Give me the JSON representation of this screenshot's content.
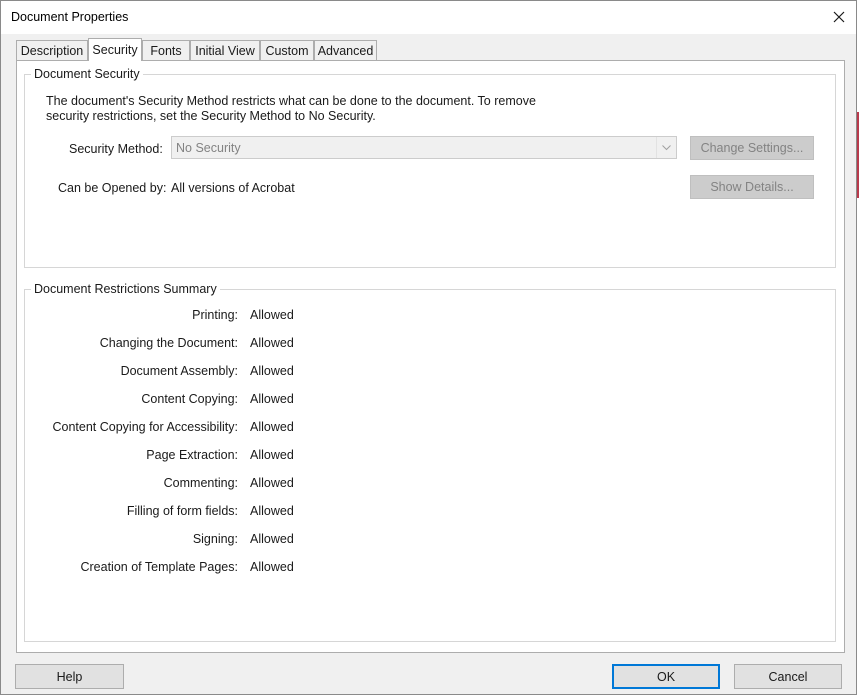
{
  "window": {
    "title": "Document Properties"
  },
  "tabs": [
    {
      "label": "Description",
      "active": false
    },
    {
      "label": "Security",
      "active": true
    },
    {
      "label": "Fonts",
      "active": false
    },
    {
      "label": "Initial View",
      "active": false
    },
    {
      "label": "Custom",
      "active": false
    },
    {
      "label": "Advanced",
      "active": false
    }
  ],
  "document_security": {
    "group_label": "Document Security",
    "description_line1": "The document's Security Method restricts what can be done to the document. To remove",
    "description_line2": "security restrictions, set the Security Method to No Security.",
    "method_label": "Security Method:",
    "method_value": "No Security",
    "change_settings_label": "Change Settings...",
    "opened_by_label": "Can be Opened by:",
    "opened_by_value": "All versions of Acrobat",
    "show_details_label": "Show Details..."
  },
  "restrictions": {
    "group_label": "Document Restrictions Summary",
    "rows": [
      {
        "label": "Printing:",
        "value": "Allowed"
      },
      {
        "label": "Changing the Document:",
        "value": "Allowed"
      },
      {
        "label": "Document Assembly:",
        "value": "Allowed"
      },
      {
        "label": "Content Copying:",
        "value": "Allowed"
      },
      {
        "label": "Content Copying for Accessibility:",
        "value": "Allowed"
      },
      {
        "label": "Page Extraction:",
        "value": "Allowed"
      },
      {
        "label": "Commenting:",
        "value": "Allowed"
      },
      {
        "label": "Filling of form fields:",
        "value": "Allowed"
      },
      {
        "label": "Signing:",
        "value": "Allowed"
      },
      {
        "label": "Creation of Template Pages:",
        "value": "Allowed"
      }
    ]
  },
  "footer": {
    "help_label": "Help",
    "ok_label": "OK",
    "cancel_label": "Cancel"
  },
  "colors": {
    "default_button_border": "#0078d7",
    "disabled_text": "#838383"
  },
  "icons": {
    "close": "close-icon",
    "dropdown": "chevron-down-icon"
  }
}
